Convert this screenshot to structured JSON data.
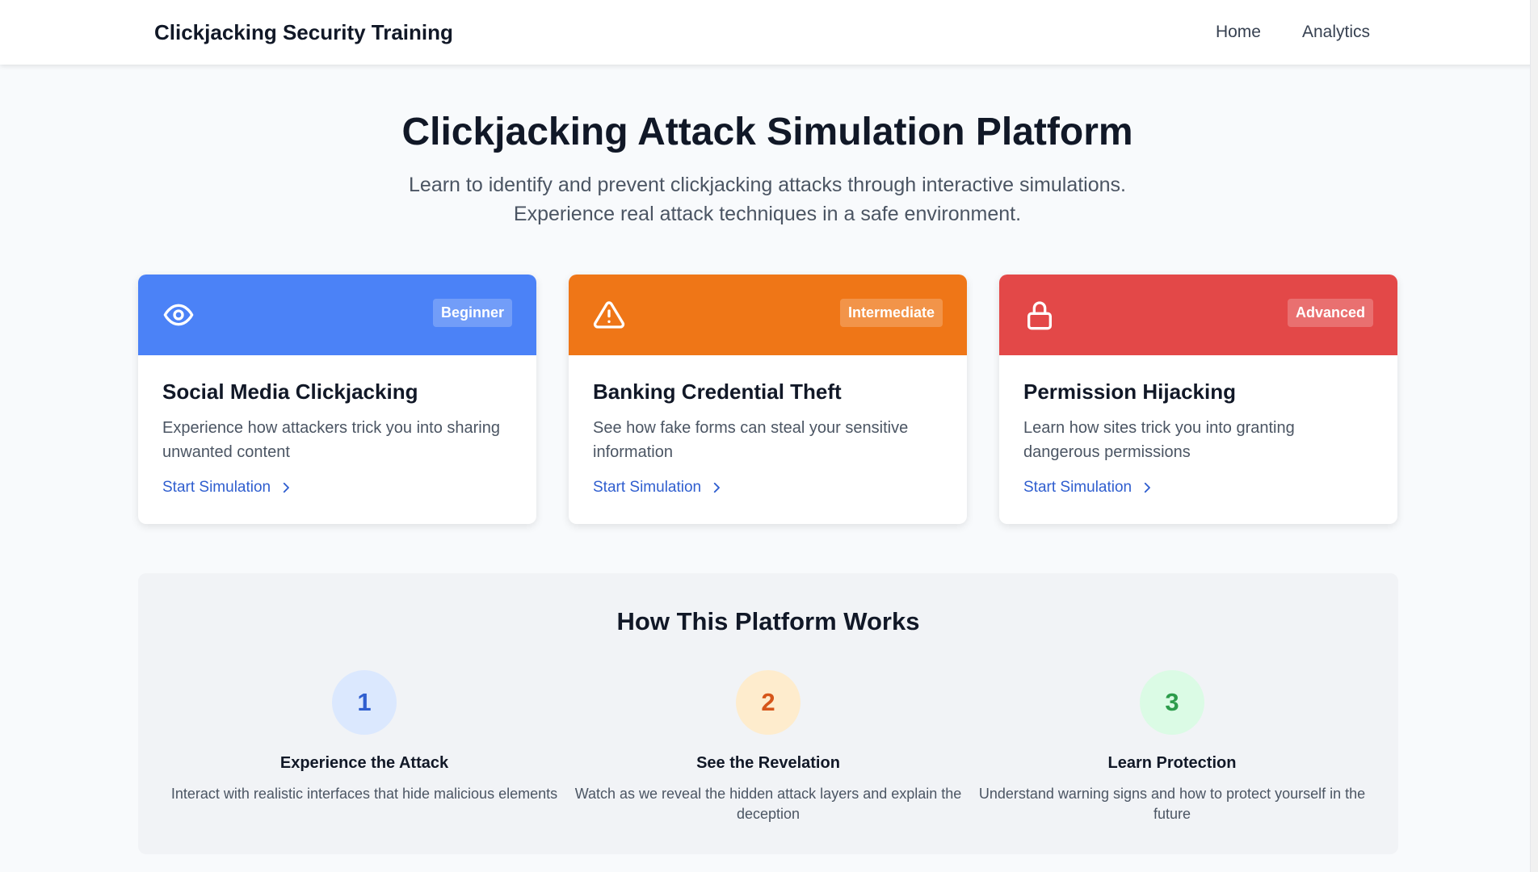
{
  "nav": {
    "brand": "Clickjacking Security Training",
    "links": [
      "Home",
      "Analytics"
    ]
  },
  "hero": {
    "title": "Clickjacking Attack Simulation Platform",
    "subtitle_line1": "Learn to identify and prevent clickjacking attacks through interactive simulations.",
    "subtitle_line2": "Experience real attack techniques in a safe environment."
  },
  "cards": [
    {
      "icon": "eye-icon",
      "badge": "Beginner",
      "color": "#4b82f7",
      "title": "Social Media Clickjacking",
      "description": "Experience how attackers trick you into sharing unwanted content",
      "link": "Start Simulation"
    },
    {
      "icon": "warning-icon",
      "badge": "Intermediate",
      "color": "#ef7617",
      "title": "Banking Credential Theft",
      "description": "See how fake forms can steal your sensitive information",
      "link": "Start Simulation"
    },
    {
      "icon": "lock-icon",
      "badge": "Advanced",
      "color": "#e34848",
      "title": "Permission Hijacking",
      "description": "Learn how sites trick you into granting dangerous permissions",
      "link": "Start Simulation"
    }
  ],
  "how": {
    "title": "How This Platform Works",
    "steps": [
      {
        "number": "1",
        "title": "Experience the Attack",
        "description": "Interact with realistic interfaces that hide malicious elements",
        "circle_bg": "#dbe8fe",
        "circle_fg": "#2f5ecf"
      },
      {
        "number": "2",
        "title": "See the Revelation",
        "description": "Watch as we reveal the hidden attack layers and explain the deception",
        "circle_bg": "#feeccd",
        "circle_fg": "#d6561a"
      },
      {
        "number": "3",
        "title": "Learn Protection",
        "description": "Understand warning signs and how to protect yourself in the future",
        "circle_bg": "#dbfbe5",
        "circle_fg": "#2c9c4b"
      }
    ]
  }
}
